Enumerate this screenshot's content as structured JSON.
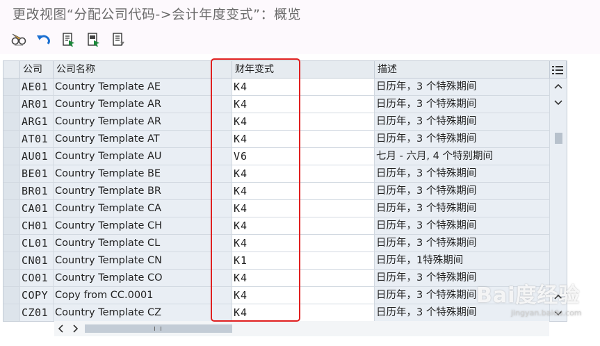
{
  "window": {
    "title": "更改视图“分配公司代码->会计年度变式”：概览"
  },
  "toolbar": {
    "buttons": [
      {
        "icon": "glasses-icon"
      },
      {
        "icon": "undo-icon"
      },
      {
        "icon": "select-all-icon"
      },
      {
        "icon": "select-block-icon"
      },
      {
        "icon": "deselect-all-icon"
      }
    ]
  },
  "table": {
    "headers": {
      "code": "公司",
      "name": "公司名称",
      "variant": "财年变式",
      "desc": "描述"
    },
    "rows": [
      {
        "code": "AE01",
        "name": "Country Template AE",
        "variant": "K4",
        "desc": "日历年，3 个特殊期间"
      },
      {
        "code": "AR01",
        "name": "Country Template AR",
        "variant": "K4",
        "desc": "日历年，3 个特殊期间"
      },
      {
        "code": "ARG1",
        "name": "Country Template AR",
        "variant": "K4",
        "desc": "日历年，3 个特殊期间"
      },
      {
        "code": "AT01",
        "name": "Country Template AT",
        "variant": "K4",
        "desc": "日历年，3 个特殊期间"
      },
      {
        "code": "AU01",
        "name": "Country Template AU",
        "variant": "V6",
        "desc": "七月 - 六月, 4 个特别期间"
      },
      {
        "code": "BE01",
        "name": "Country Template BE",
        "variant": "K4",
        "desc": "日历年，3 个特殊期间"
      },
      {
        "code": "BR01",
        "name": "Country Template BR",
        "variant": "K4",
        "desc": "日历年，3 个特殊期间"
      },
      {
        "code": "CA01",
        "name": "Country Template CA",
        "variant": "K4",
        "desc": "日历年，3 个特殊期间"
      },
      {
        "code": "CH01",
        "name": "Country Template CH",
        "variant": "K4",
        "desc": "日历年，3 个特殊期间"
      },
      {
        "code": "CL01",
        "name": "Country Template CL",
        "variant": "K4",
        "desc": "日历年，3 个特殊期间"
      },
      {
        "code": "CN01",
        "name": "Country Template CN",
        "variant": "K1",
        "desc": "日历年，1特殊期间"
      },
      {
        "code": "CO01",
        "name": "Country Template CO",
        "variant": "K4",
        "desc": "日历年，3 个特殊期间"
      },
      {
        "code": "COPY",
        "name": "Copy from CC.0001",
        "variant": "K4",
        "desc": "日历年，3 个特殊期间"
      },
      {
        "code": "CZ01",
        "name": "Country Template CZ",
        "variant": "K4",
        "desc": "日历年，3 个特殊期间"
      }
    ]
  },
  "watermark": {
    "main": "Bai度经验",
    "sub": "jingyan.baidu.com"
  }
}
